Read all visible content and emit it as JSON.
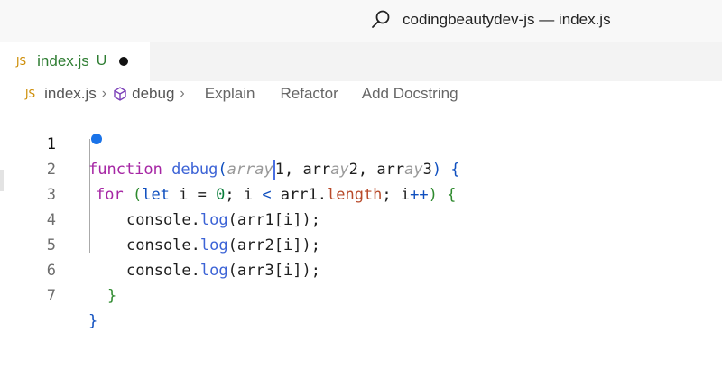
{
  "window": {
    "title": "codingbeautydev-js — index.js"
  },
  "tab": {
    "badge": "JS",
    "name": "index.js",
    "status": "U"
  },
  "breadcrumb": {
    "badge": "JS",
    "file": "index.js",
    "symbol": "debug",
    "actions": [
      "Explain",
      "Refactor",
      "Add Docstring"
    ]
  },
  "editor": {
    "line_numbers": [
      "1",
      "2",
      "3",
      "4",
      "5",
      "6",
      "7"
    ],
    "line1": {
      "kw": "function",
      "fn": "debug",
      "open": "(",
      "h1": "array",
      "p1": "1, arr",
      "h2": "ay",
      "p2": "2, arr",
      "h3": "ay",
      "p3": "3",
      "close": ")",
      "brace": " {"
    },
    "line2": {
      "kw": "for",
      "open": " (",
      "let": "let",
      "mid": " i = ",
      "zero": "0",
      "mid2": "; i ",
      "lt": "<",
      "mid3": " arr1.",
      "prop": "length",
      "mid4": "; i",
      "inc": "++",
      "close": ")",
      "brace": " {"
    },
    "line3": {
      "obj": "console.",
      "fn": "log",
      "args": "(arr1[i]);"
    },
    "line4": {
      "obj": "console.",
      "fn": "log",
      "args": "(arr2[i]);"
    },
    "line5": {
      "obj": "console.",
      "fn": "log",
      "args": "(arr3[i]);"
    },
    "line6": {
      "brace": "}"
    },
    "line7": {
      "brace": "}"
    }
  }
}
